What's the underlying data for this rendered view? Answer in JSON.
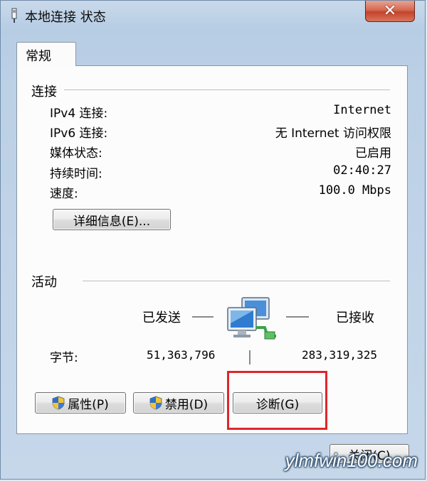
{
  "window": {
    "title": "本地连接 状态",
    "close_label": "✕"
  },
  "tabs": [
    {
      "label": "常规"
    }
  ],
  "connection": {
    "section_title": "连接",
    "rows": [
      {
        "label": "IPv4 连接:",
        "value": "Internet"
      },
      {
        "label": "IPv6 连接:",
        "value": "无 Internet 访问权限"
      },
      {
        "label": "媒体状态:",
        "value": "已启用"
      },
      {
        "label": "持续时间:",
        "value": "02:40:27"
      },
      {
        "label": "速度:",
        "value": "100.0 Mbps"
      }
    ],
    "details_button": "详细信息(E)..."
  },
  "activity": {
    "section_title": "活动",
    "sent_label": "已发送",
    "received_label": "已接收",
    "bytes_label": "字节:",
    "bytes_sent": "51,363,796",
    "bytes_received": "283,319,325",
    "icon": "network-computers-icon"
  },
  "buttons": {
    "properties": "属性(P)",
    "disable": "禁用(D)",
    "diagnose": "诊断(G)",
    "close": "关闭(C)"
  },
  "icons": {
    "shield": "uac-shield-icon"
  },
  "watermark": "ylmfwin100.com",
  "colors": {
    "highlight_border": "#e0262b",
    "close_button": "#c3442b"
  }
}
